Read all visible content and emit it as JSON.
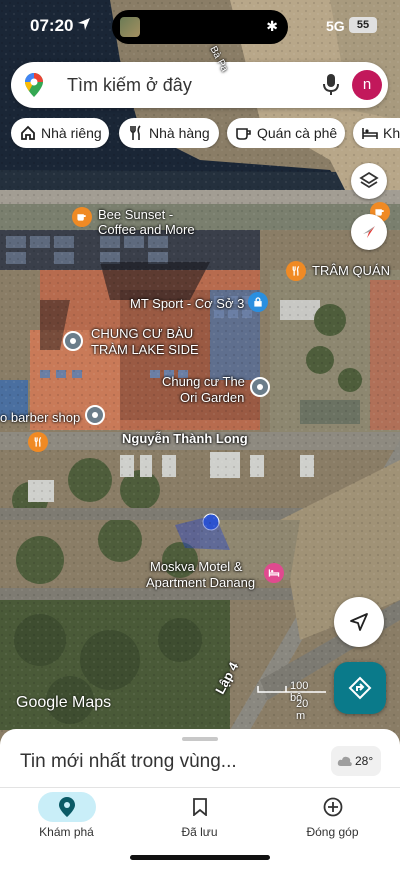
{
  "status_bar": {
    "time": "07:20",
    "network": "5G",
    "battery": "55"
  },
  "search": {
    "placeholder": "Tìm kiếm ở đây",
    "avatar_initial": "n"
  },
  "chips": [
    {
      "label": "Nhà riêng",
      "icon": "home-icon"
    },
    {
      "label": "Nhà hàng",
      "icon": "restaurant-icon"
    },
    {
      "label": "Quán cà phê",
      "icon": "cafe-icon"
    },
    {
      "label": "Khá",
      "icon": "hotel-icon"
    }
  ],
  "map": {
    "pois": {
      "bee_sunset": {
        "line1": "Bee Sunset -",
        "line2": "Coffee and More"
      },
      "tram_quan": {
        "name": "TRÂM QUÁN"
      },
      "mt_sport": {
        "name": "MT Sport - Cơ Sở 3"
      },
      "bau_tram": {
        "line1": "CHUNG CƯ BÀU",
        "line2": "TRÀM LAKE SIDE"
      },
      "ori_garden": {
        "line1": "Chung cư The",
        "line2": "Ori Garden"
      },
      "barber": {
        "name": "o barber shop"
      },
      "moskva": {
        "line1": "Moskva Motel &",
        "line2": "Apartment Danang"
      }
    },
    "roads": {
      "nguyen_thanh_long": "Nguyễn Thành Long",
      "lap_4": "Lập 4",
      "top_road": "Bà Pa"
    },
    "scale": {
      "imperial": "100 bộ",
      "metric": "20 m"
    },
    "logo": "Google Maps",
    "colors": {
      "water": "#1a2636",
      "cafe_marker": "#f08a24",
      "place_marker": "#6b7d8a",
      "sport_marker": "#2a8fe0",
      "hotel_marker": "#e04a8f"
    }
  },
  "sheet": {
    "title": "Tin mới nhất trong vùng...",
    "weather": "28°"
  },
  "nav": {
    "explore": "Khám phá",
    "saved": "Đã lưu",
    "contribute": "Đóng góp"
  }
}
